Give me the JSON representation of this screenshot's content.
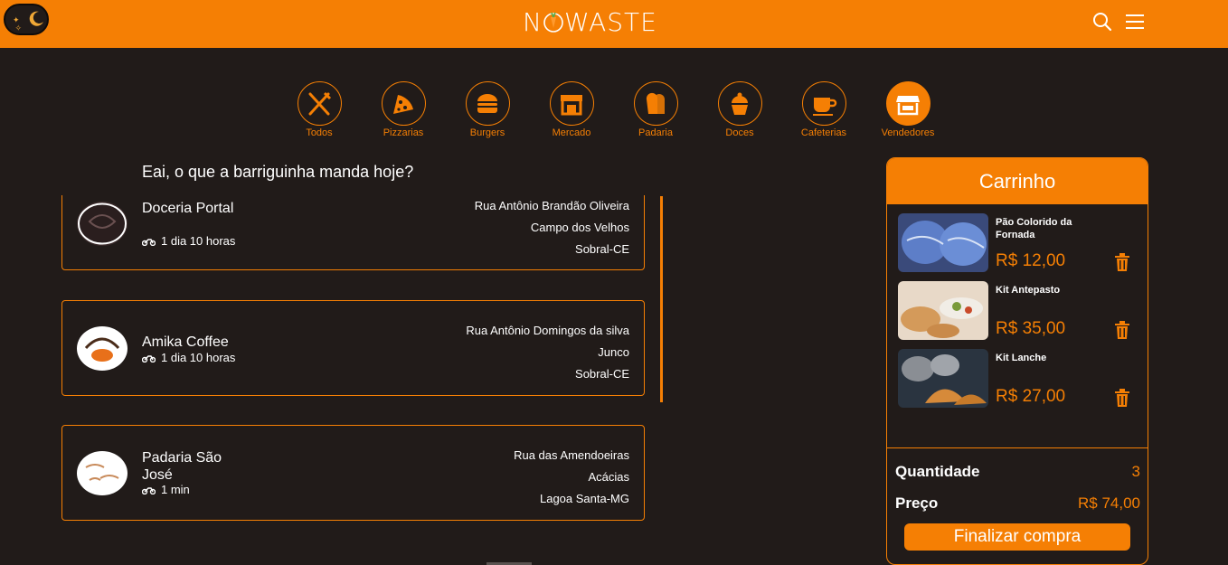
{
  "header": {
    "logo": "N O WASTE",
    "logo_left": "N",
    "logo_right": "WASTE"
  },
  "categories": [
    {
      "label": "Todos",
      "icon": "fork-knife-icon"
    },
    {
      "label": "Pizzarias",
      "icon": "pizza-icon"
    },
    {
      "label": "Burgers",
      "icon": "burger-icon"
    },
    {
      "label": "Mercado",
      "icon": "store-icon"
    },
    {
      "label": "Padaria",
      "icon": "bread-icon"
    },
    {
      "label": "Doces",
      "icon": "cupcake-icon"
    },
    {
      "label": "Cafeterias",
      "icon": "coffee-cup-icon"
    },
    {
      "label": "Vendedores",
      "icon": "shop-icon",
      "active": true
    }
  ],
  "greeting": "Eai, o que a barriguinha manda hoje?",
  "stores": [
    {
      "name": "Doceria Portal",
      "time": "1 dia 10 horas",
      "street": "Rua Antônio Brandão Oliveira",
      "district": "Campo dos Velhos",
      "city": "Sobral-CE"
    },
    {
      "name": "Amika Coffee",
      "time": "1 dia 10 horas",
      "street": "Rua Antônio Domingos da silva",
      "district": "Junco",
      "city": "Sobral-CE"
    },
    {
      "name": "Padaria São José",
      "time": "1 min",
      "street": "Rua das Amendoeiras",
      "district": "Acácias",
      "city": "Lagoa Santa-MG"
    }
  ],
  "cart": {
    "title": "Carrinho",
    "items": [
      {
        "name": "Pão Colorido da Fornada",
        "price": "R$ 12,00"
      },
      {
        "name": "Kit Antepasto",
        "price": "R$ 35,00"
      },
      {
        "name": "Kit Lanche",
        "price": "R$ 27,00"
      }
    ],
    "quantity_label": "Quantidade",
    "quantity": "3",
    "price_label": "Preço",
    "total": "R$ 74,00",
    "checkout_label": "Finalizar compra"
  },
  "colors": {
    "accent": "#f57f04",
    "background": "#211b19"
  }
}
